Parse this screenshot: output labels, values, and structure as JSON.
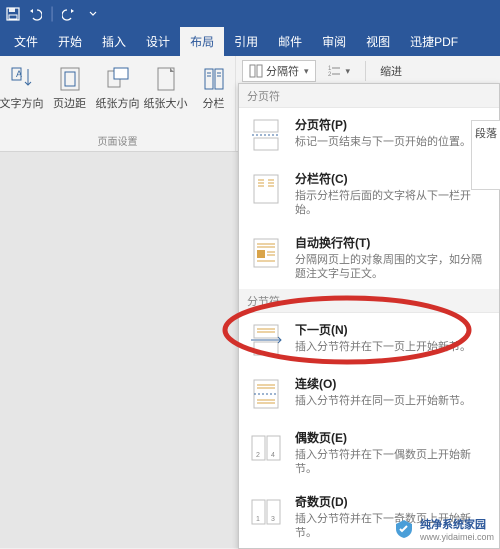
{
  "titlebar": {
    "save_tip": "保存",
    "undo_tip": "撤销",
    "redo_tip": "恢复"
  },
  "tabs": {
    "file": "文件",
    "home": "开始",
    "insert": "插入",
    "design": "设计",
    "layout": "布局",
    "references": "引用",
    "mail": "邮件",
    "review": "审阅",
    "view": "视图",
    "xunjie": "迅捷PDF"
  },
  "ribbon": {
    "text_direction": "文字方向",
    "margins": "页边距",
    "orientation": "纸张方向",
    "size": "纸张大小",
    "columns": "分栏",
    "group_page_setup": "页面设置",
    "breaks_label": "分隔符",
    "indent_label": "缩进",
    "paragraph_label": "段落"
  },
  "menu": {
    "header_page": "分页符",
    "page_break": {
      "title": "分页符(P)",
      "desc": "标记一页结束与下一页开始的位置。"
    },
    "column_break": {
      "title": "分栏符(C)",
      "desc": "指示分栏符后面的文字将从下一栏开始。"
    },
    "text_wrap": {
      "title": "自动换行符(T)",
      "desc": "分隔网页上的对象周围的文字，如分隔题注文字与正文。"
    },
    "header_section": "分节符",
    "next_page": {
      "title": "下一页(N)",
      "desc": "插入分节符并在下一页上开始新节。"
    },
    "continuous": {
      "title": "连续(O)",
      "desc": "插入分节符并在同一页上开始新节。"
    },
    "even_page": {
      "title": "偶数页(E)",
      "desc": "插入分节符并在下一偶数页上开始新节。"
    },
    "odd_page": {
      "title": "奇数页(D)",
      "desc": "插入分节符并在下一奇数页上开始新节。"
    }
  },
  "watermark": {
    "brand": "纯净系统家园",
    "url": "www.yidaimei.com"
  }
}
